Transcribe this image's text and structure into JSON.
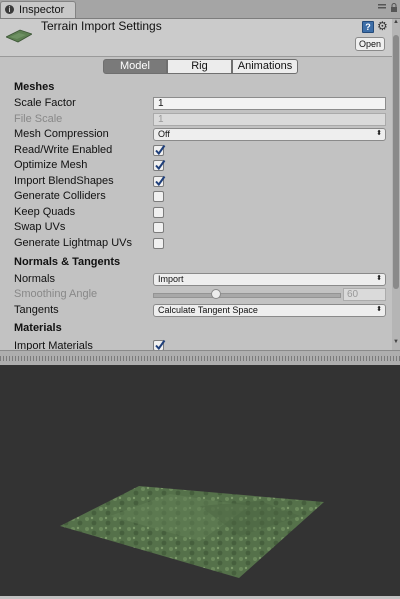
{
  "window": {
    "tab_label": "Inspector",
    "tab_icon": "info-icon",
    "title": "Terrain Import Settings",
    "open_label": "Open",
    "help_icon": "help-icon",
    "settings_icon": "gear-icon",
    "help_glyph": "?",
    "gear_glyph": "⚙",
    "tab_glyph": "i"
  },
  "tabs": [
    {
      "label": "Model",
      "active": true
    },
    {
      "label": "Rig",
      "active": false
    },
    {
      "label": "Animations",
      "active": false
    }
  ],
  "sections": {
    "meshes": "Meshes",
    "normals": "Normals & Tangents",
    "materials": "Materials"
  },
  "meshes": {
    "scale_factor": {
      "label": "Scale Factor",
      "value": "1"
    },
    "file_scale": {
      "label": "File Scale",
      "value": "1"
    },
    "mesh_compression": {
      "label": "Mesh Compression",
      "value": "Off"
    },
    "read_write": {
      "label": "Read/Write Enabled",
      "checked": true
    },
    "optimize": {
      "label": "Optimize Mesh",
      "checked": true
    },
    "blend_shapes": {
      "label": "Import BlendShapes",
      "checked": true
    },
    "colliders": {
      "label": "Generate Colliders",
      "checked": false
    },
    "keep_quads": {
      "label": "Keep Quads",
      "checked": false
    },
    "swap_uvs": {
      "label": "Swap UVs",
      "checked": false
    },
    "lightmap_uvs": {
      "label": "Generate Lightmap UVs",
      "checked": false
    }
  },
  "normals": {
    "normals": {
      "label": "Normals",
      "value": "Import"
    },
    "smoothing": {
      "label": "Smoothing Angle",
      "value": "60",
      "slider_fraction": 0.33
    },
    "tangents": {
      "label": "Tangents",
      "value": "Calculate Tangent Space"
    }
  },
  "materials": {
    "import": {
      "label": "Import Materials",
      "checked": true
    }
  },
  "colors": {
    "preview_bg": "#333333",
    "terrain": "#5a7a4e",
    "accent_check": "#2b4f8a"
  }
}
